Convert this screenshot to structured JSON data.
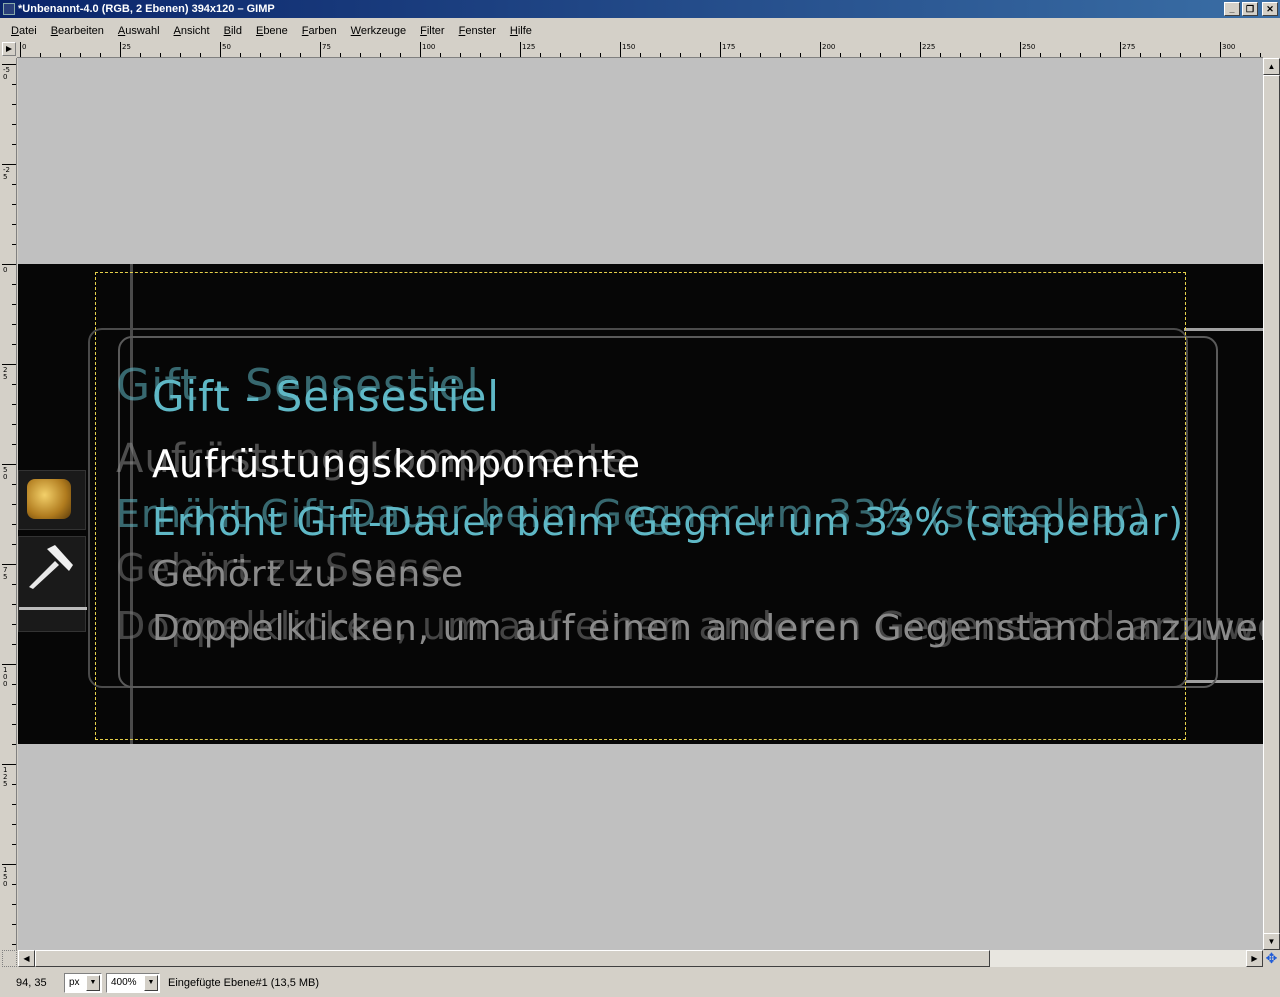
{
  "window": {
    "title": "*Unbenannt-4.0 (RGB, 2 Ebenen) 394x120 – GIMP",
    "minimize_glyph": "_",
    "restore_glyph": "❐",
    "close_glyph": "✕"
  },
  "menu": [
    "Datei",
    "Bearbeiten",
    "Auswahl",
    "Ansicht",
    "Bild",
    "Ebene",
    "Farben",
    "Werkzeuge",
    "Filter",
    "Fenster",
    "Hilfe"
  ],
  "rulers": {
    "horizontal_labels": [
      "0",
      "25",
      "50",
      "75",
      "100",
      "125",
      "150",
      "175",
      "200",
      "225",
      "250",
      "275",
      "300"
    ],
    "vertical_labels": [
      "-50",
      "-25",
      "0",
      "25",
      "50",
      "75",
      "100",
      "125",
      "150"
    ]
  },
  "canvas": {
    "tooltip": {
      "title": "Gift - Sensestiel",
      "type": "Aufrüstungskomponente",
      "effect": "Erhöht Gift-Dauer beim Gegner um 33% (stapelbar)",
      "belongs_to": "Gehört zu Sense",
      "hint": "Doppelklicken, um auf einen anderen Gegenstand anzuwenden"
    },
    "colors": {
      "title": "#5fb8c6",
      "effect": "#5fb8c6",
      "type": "#ffffff",
      "muted": "#8a8a8a",
      "background": "#060606"
    }
  },
  "statusbar": {
    "coords": "94, 35",
    "unit": "px",
    "zoom": "400%",
    "message": "Eingefügte Ebene#1 (13,5 MB)"
  },
  "icons": {
    "navigate": "✥",
    "scroll_up": "▲",
    "scroll_down": "▼",
    "scroll_left": "◀",
    "scroll_right": "▶",
    "dropdown": "▼"
  }
}
